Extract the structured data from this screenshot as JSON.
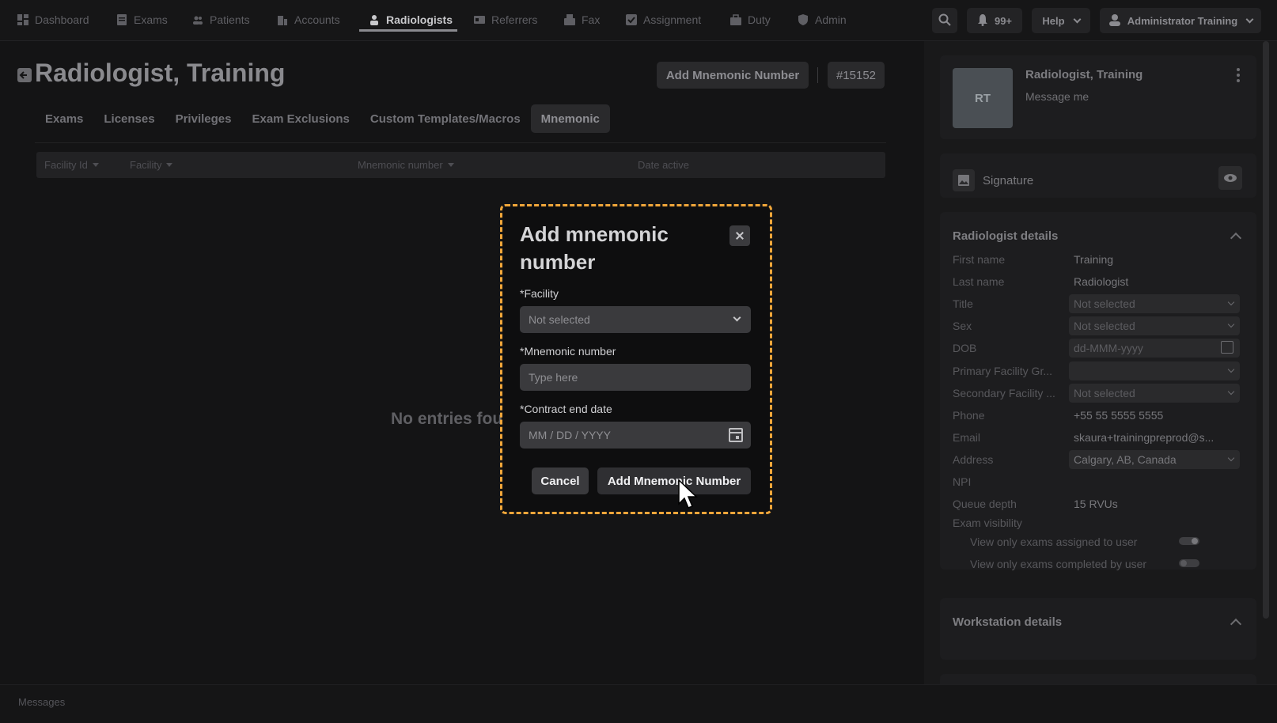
{
  "nav": {
    "items": [
      {
        "label": "Dashboard",
        "icon": "dashboard-icon"
      },
      {
        "label": "Exams",
        "icon": "exams-icon"
      },
      {
        "label": "Patients",
        "icon": "patients-icon"
      },
      {
        "label": "Accounts",
        "icon": "accounts-icon"
      },
      {
        "label": "Radiologists",
        "icon": "radiologist-icon"
      },
      {
        "label": "Referrers",
        "icon": "referrers-icon"
      },
      {
        "label": "Fax",
        "icon": "fax-icon"
      },
      {
        "label": "Assignment",
        "icon": "assignment-icon"
      },
      {
        "label": "Duty",
        "icon": "duty-icon"
      },
      {
        "label": "Admin",
        "icon": "admin-icon"
      }
    ],
    "active": "Radiologists",
    "notifications": "99+",
    "help_label": "Help",
    "user_label": "Administrator Training"
  },
  "page": {
    "title": "Radiologist, Training",
    "add_button": "Add Mnemonic Number",
    "id_badge": "#15152",
    "tabs": [
      "Exams",
      "Licenses",
      "Privileges",
      "Exam Exclusions",
      "Custom Templates/Macros",
      "Mnemonic"
    ],
    "active_tab": "Mnemonic",
    "table_headers": [
      "Facility Id",
      "Facility",
      "Mnemonic number",
      "Date active"
    ],
    "empty_text": "No entries fou"
  },
  "footer": {
    "messages": "Messages"
  },
  "profile": {
    "initials": "RT",
    "name": "Radiologist, Training",
    "message_link": "Message me",
    "signature_label": "Signature",
    "details_title": "Radiologist details",
    "workstation_title": "Workstation details",
    "fields": {
      "first_name": {
        "label": "First name",
        "value": "Training"
      },
      "last_name": {
        "label": "Last name",
        "value": "Radiologist"
      },
      "title": {
        "label": "Title",
        "value": "Not selected"
      },
      "sex": {
        "label": "Sex",
        "value": "Not selected"
      },
      "dob": {
        "label": "DOB",
        "placeholder": "dd-MMM-yyyy"
      },
      "primary_facility": {
        "label": "Primary Facility Gr...",
        "value": ""
      },
      "secondary_facility": {
        "label": "Secondary Facility ...",
        "value": "Not selected"
      },
      "phone": {
        "label": "Phone",
        "value": "+55 55 5555 5555"
      },
      "email": {
        "label": "Email",
        "value": "skaura+trainingpreprod@s..."
      },
      "address": {
        "label": "Address",
        "value": "Calgary, AB, Canada"
      },
      "npi": {
        "label": "NPI",
        "value": ""
      },
      "queue_depth": {
        "label": "Queue depth",
        "value": "15 RVUs"
      },
      "exam_visibility": {
        "label": "Exam visibility"
      },
      "view_assigned": {
        "label": "View only exams assigned to user",
        "on": true
      },
      "view_completed": {
        "label": "View only exams completed by user",
        "on": false
      }
    }
  },
  "modal": {
    "title": "Add mnemonic number",
    "facility_label": "*Facility",
    "facility_value": "Not selected",
    "mnemonic_label": "*Mnemonic number",
    "mnemonic_placeholder": "Type here",
    "end_date_label": "*Contract end date",
    "end_date_placeholder": "MM / DD / YYYY",
    "cancel_label": "Cancel",
    "submit_label": "Add Mnemonic Number",
    "highlight_color": "#f0a63a"
  }
}
